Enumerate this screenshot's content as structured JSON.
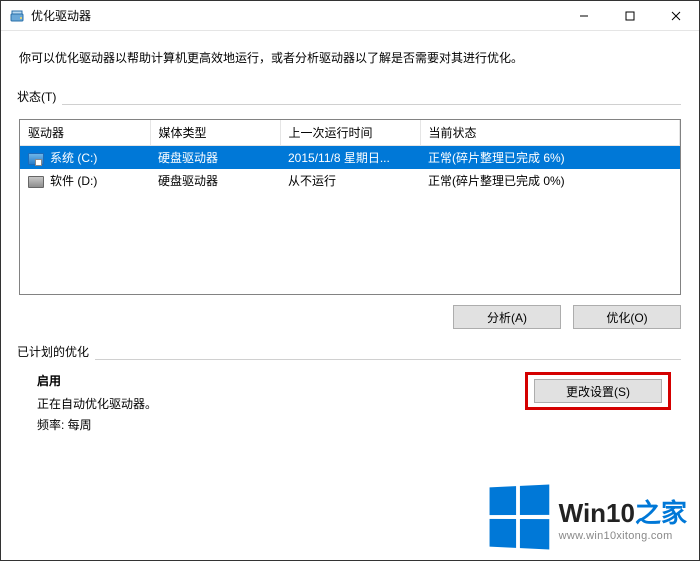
{
  "window": {
    "title": "优化驱动器"
  },
  "description": "你可以优化驱动器以帮助计算机更高效地运行，或者分析驱动器以了解是否需要对其进行优化。",
  "status": {
    "label": "状态(T)",
    "columns": {
      "drive": "驱动器",
      "media": "媒体类型",
      "last_run": "上一次运行时间",
      "current": "当前状态"
    },
    "rows": [
      {
        "selected": true,
        "icon": "sys",
        "drive": "系统 (C:)",
        "media": "硬盘驱动器",
        "last_run": "2015/11/8 星期日...",
        "current": "正常(碎片整理已完成 6%)"
      },
      {
        "selected": false,
        "icon": "hdd",
        "drive": "软件 (D:)",
        "media": "硬盘驱动器",
        "last_run": "从不运行",
        "current": "正常(碎片整理已完成 0%)"
      }
    ],
    "buttons": {
      "analyze": "分析(A)",
      "optimize": "优化(O)"
    }
  },
  "schedule": {
    "label": "已计划的优化",
    "enabled_title": "启用",
    "line1": "正在自动优化驱动器。",
    "line2": "频率: 每周",
    "change_button": "更改设置(S)"
  },
  "watermark": {
    "brand_a": "Win10",
    "brand_b": "之家",
    "url": "www.win10xitong.com"
  }
}
